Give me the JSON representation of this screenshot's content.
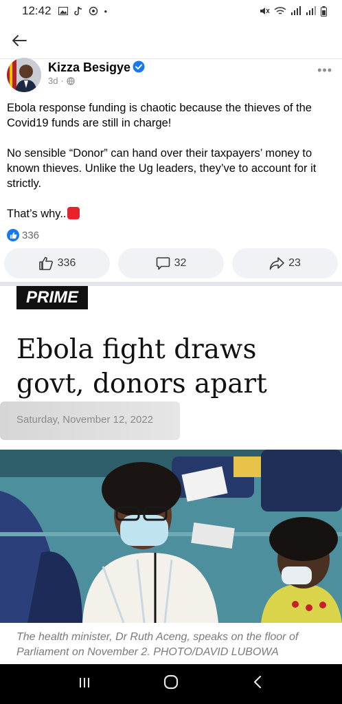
{
  "status_bar": {
    "time": "12:42",
    "left_icons": [
      "image-icon",
      "tiktok-icon",
      "whatsapp-icon",
      "dot-icon"
    ],
    "right_icons": [
      "mute-icon",
      "wifi-icon",
      "signal-icon",
      "signal-icon",
      "battery-icon"
    ]
  },
  "nav": {
    "back_icon": "back-arrow-icon"
  },
  "post": {
    "author": "Kizza Besigye",
    "time_ago": "3d",
    "separator": "·",
    "visibility_icon": "globe-icon",
    "paragraph_1": "Ebola response funding is chaotic because the thieves of the Covid19 funds are still in charge!",
    "paragraph_2": "No sensible “Donor” can hand over their taxpayers’ money to known thieves. Unlike the Ug leaders, they’ve to account for it strictly.",
    "paragraph_3": "That’s why..",
    "reaction_count": "336",
    "actions": {
      "like_count": "336",
      "comment_count": "32",
      "share_count": "23"
    }
  },
  "article": {
    "tag": "PRIME",
    "headline": "Ebola fight draws govt, donors apart",
    "date": "Saturday, November 12, 2022",
    "caption": "The health minister, Dr Ruth Aceng, speaks on the floor of Parliament on November 2. PHOTO/DAVID LUBOWA"
  },
  "colors": {
    "facebook_blue": "#1877f2",
    "action_bg": "#f0f2f5",
    "red_square": "#e8222a"
  }
}
